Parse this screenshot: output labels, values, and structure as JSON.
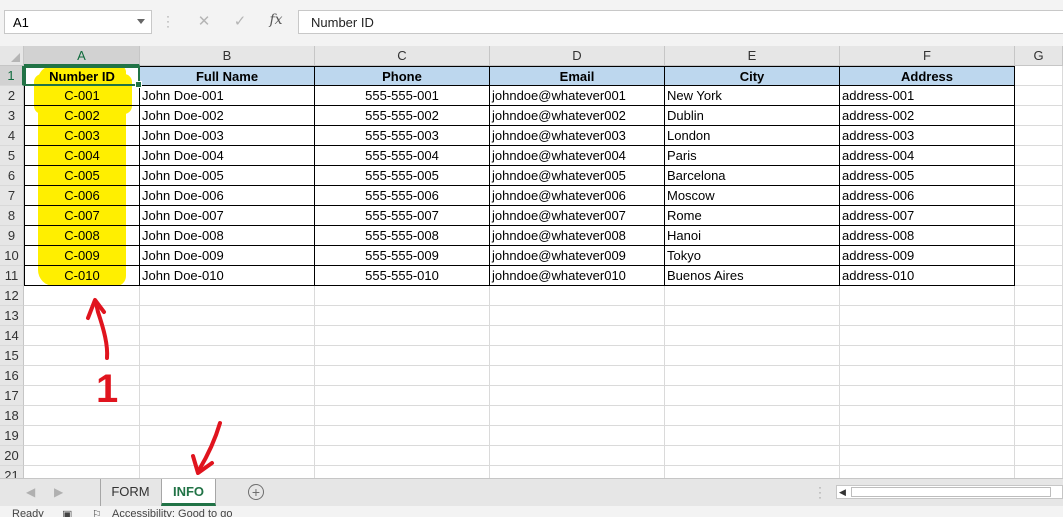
{
  "formula_bar": {
    "name_box": "A1",
    "cancel_icon": "✕",
    "enter_icon": "✓",
    "fx_label": "fx",
    "formula": "Number ID"
  },
  "grid": {
    "columns": [
      "A",
      "B",
      "C",
      "D",
      "E",
      "F",
      "G"
    ],
    "row_numbers": [
      "1",
      "2",
      "3",
      "4",
      "5",
      "6",
      "7",
      "8",
      "9",
      "10",
      "11",
      "12",
      "13",
      "14",
      "15",
      "16",
      "17",
      "18",
      "19",
      "20",
      "21"
    ],
    "table_headers": [
      "Number ID",
      "Full Name",
      "Phone",
      "Email",
      "City",
      "Address"
    ],
    "table_rows": [
      [
        "C-001",
        "John Doe-001",
        "555-555-001",
        "johndoe@whatever001",
        "New York",
        "address-001"
      ],
      [
        "C-002",
        "John Doe-002",
        "555-555-002",
        "johndoe@whatever002",
        "Dublin",
        "address-002"
      ],
      [
        "C-003",
        "John Doe-003",
        "555-555-003",
        "johndoe@whatever003",
        "London",
        "address-003"
      ],
      [
        "C-004",
        "John Doe-004",
        "555-555-004",
        "johndoe@whatever004",
        "Paris",
        "address-004"
      ],
      [
        "C-005",
        "John Doe-005",
        "555-555-005",
        "johndoe@whatever005",
        "Barcelona",
        "address-005"
      ],
      [
        "C-006",
        "John Doe-006",
        "555-555-006",
        "johndoe@whatever006",
        "Moscow",
        "address-006"
      ],
      [
        "C-007",
        "John Doe-007",
        "555-555-007",
        "johndoe@whatever007",
        "Rome",
        "address-007"
      ],
      [
        "C-008",
        "John Doe-008",
        "555-555-008",
        "johndoe@whatever008",
        "Hanoi",
        "address-008"
      ],
      [
        "C-009",
        "John Doe-009",
        "555-555-009",
        "johndoe@whatever009",
        "Tokyo",
        "address-009"
      ],
      [
        "C-010",
        "John Doe-010",
        "555-555-010",
        "johndoe@whatever010",
        "Buenos Aires",
        "address-010"
      ]
    ]
  },
  "annotations": {
    "number_label": "1",
    "highlight_color": "#ffef00",
    "ink_color": "#e0141e"
  },
  "sheet_tabs": {
    "tabs": [
      "FORM",
      "INFO"
    ],
    "active": "INFO",
    "add_icon": "+"
  },
  "status_bar": {
    "ready": "Ready",
    "accessibility": "Accessibility: Good to go"
  },
  "colors": {
    "accent": "#217346",
    "header_fill": "#bdd7ee"
  }
}
